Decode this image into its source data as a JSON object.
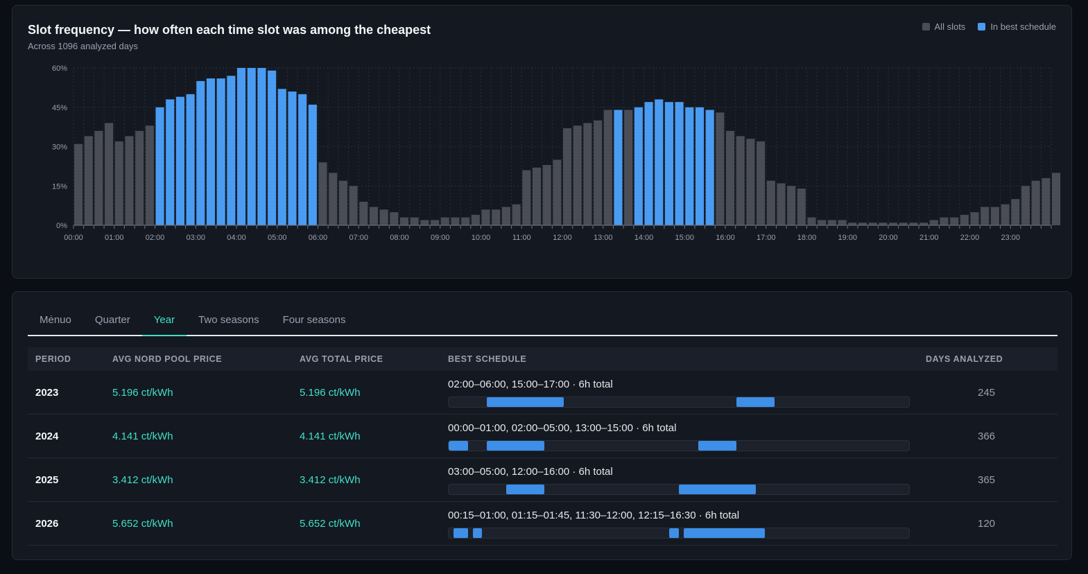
{
  "chart": {
    "title": "Slot frequency — how often each time slot was among the cheapest",
    "subtitle": "Across 1096 analyzed days",
    "legend": [
      {
        "label": "All slots",
        "color": "#4a4d55"
      },
      {
        "label": "In best schedule",
        "color": "#4a9cf2"
      }
    ]
  },
  "chart_data": {
    "type": "bar",
    "title": "Slot frequency — how often each time slot was among the cheapest",
    "xlabel": "",
    "ylabel": "",
    "ylim": [
      0,
      60
    ],
    "yticks": [
      "0%",
      "15%",
      "30%",
      "45%",
      "60%"
    ],
    "xticks": [
      "00:00",
      "01:00",
      "02:00",
      "03:00",
      "04:00",
      "05:00",
      "06:00",
      "07:00",
      "08:00",
      "09:00",
      "10:00",
      "11:00",
      "12:00",
      "13:00",
      "14:00",
      "15:00",
      "16:00",
      "17:00",
      "18:00",
      "19:00",
      "20:00",
      "21:00",
      "22:00",
      "23:00"
    ],
    "slot_minutes": 15,
    "values": [
      31,
      34,
      36,
      39,
      32,
      34,
      36,
      38,
      45,
      48,
      49,
      50,
      55,
      56,
      56,
      57,
      60,
      60,
      60,
      59,
      52,
      51,
      50,
      46,
      24,
      20,
      17,
      15,
      9,
      7,
      6,
      5,
      3,
      3,
      2,
      2,
      3,
      3,
      3,
      4,
      6,
      6,
      7,
      8,
      21,
      22,
      23,
      25,
      37,
      38,
      39,
      40,
      44,
      44,
      44,
      45,
      47,
      48,
      47,
      47,
      45,
      45,
      44,
      43,
      36,
      34,
      33,
      32,
      17,
      16,
      15,
      14,
      3,
      2,
      2,
      2,
      1,
      1,
      1,
      1,
      1,
      1,
      1,
      1,
      2,
      3,
      3,
      4,
      5,
      7,
      7,
      8,
      10,
      15,
      17,
      18,
      20
    ],
    "in_best_schedule": [
      8,
      9,
      10,
      11,
      12,
      13,
      14,
      15,
      16,
      17,
      18,
      19,
      20,
      21,
      22,
      23,
      53,
      55,
      56,
      57,
      58,
      59,
      60,
      61,
      62
    ],
    "grid": true,
    "legend": "top-right"
  },
  "tabs": [
    {
      "label": "Mėnuo",
      "active": false
    },
    {
      "label": "Quarter",
      "active": false
    },
    {
      "label": "Year",
      "active": true
    },
    {
      "label": "Two seasons",
      "active": false
    },
    {
      "label": "Four seasons",
      "active": false
    }
  ],
  "table": {
    "headers": [
      "PERIOD",
      "AVG NORD POOL PRICE",
      "AVG TOTAL PRICE",
      "BEST SCHEDULE",
      "DAYS ANALYZED"
    ],
    "rows": [
      {
        "period": "2023",
        "avg_nord_pool": "5.196 ct/kWh",
        "avg_total": "5.196 ct/kWh",
        "schedule": "02:00–06:00, 15:00–17:00 · 6h total",
        "days": "245",
        "segments": [
          [
            2,
            6
          ],
          [
            15,
            17
          ]
        ]
      },
      {
        "period": "2024",
        "avg_nord_pool": "4.141 ct/kWh",
        "avg_total": "4.141 ct/kWh",
        "schedule": "00:00–01:00, 02:00–05:00, 13:00–15:00 · 6h total",
        "days": "366",
        "segments": [
          [
            0,
            1
          ],
          [
            2,
            5
          ],
          [
            13,
            15
          ]
        ]
      },
      {
        "period": "2025",
        "avg_nord_pool": "3.412 ct/kWh",
        "avg_total": "3.412 ct/kWh",
        "schedule": "03:00–05:00, 12:00–16:00 · 6h total",
        "days": "365",
        "segments": [
          [
            3,
            5
          ],
          [
            12,
            16
          ]
        ]
      },
      {
        "period": "2026",
        "avg_nord_pool": "5.652 ct/kWh",
        "avg_total": "5.652 ct/kWh",
        "schedule": "00:15–01:00, 01:15–01:45, 11:30–12:00, 12:15–16:30 · 6h total",
        "days": "120",
        "segments": [
          [
            0.25,
            1
          ],
          [
            1.25,
            1.75
          ],
          [
            11.5,
            12
          ],
          [
            12.25,
            16.5
          ]
        ]
      }
    ]
  }
}
